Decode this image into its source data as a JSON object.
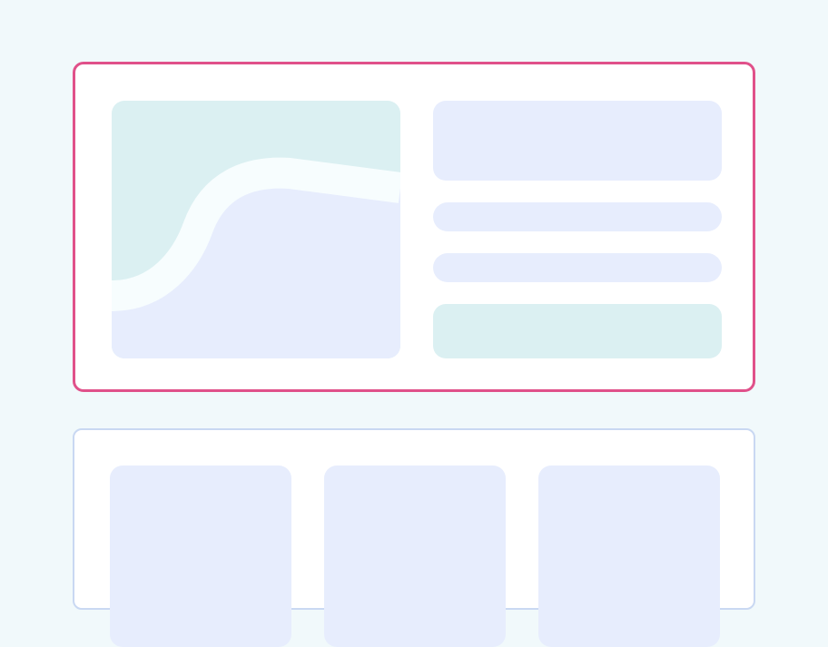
{
  "colors": {
    "page_background": "#F1F9FB",
    "card_background": "#FFFFFF",
    "selected_border": "#E0518A",
    "unselected_border": "#C9D8F2",
    "placeholder_blue": "#E7EDFD",
    "placeholder_teal": "#DBF0F2",
    "wave_stroke": "#F7FDFE"
  },
  "hero_card": {
    "selected": true,
    "image_placeholder": {
      "icon": "landscape-wave-icon"
    },
    "blocks": [
      {
        "kind": "header",
        "color_key": "placeholder_blue"
      },
      {
        "kind": "text-line",
        "color_key": "placeholder_blue"
      },
      {
        "kind": "text-line",
        "color_key": "placeholder_blue"
      },
      {
        "kind": "action",
        "color_key": "placeholder_teal"
      }
    ]
  },
  "grid_card": {
    "selected": false,
    "tiles": [
      {
        "color_key": "placeholder_blue"
      },
      {
        "color_key": "placeholder_blue"
      },
      {
        "color_key": "placeholder_blue"
      }
    ]
  }
}
